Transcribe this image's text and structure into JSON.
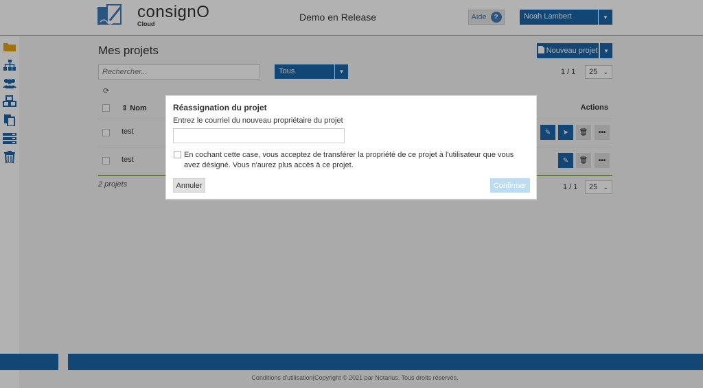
{
  "header": {
    "logo_text": "consignO",
    "logo_sub": "Cloud",
    "org_title": "Demo en Release",
    "help_label": "Aide",
    "help_icon": "?",
    "user_name": "Noah Lambert"
  },
  "sidebar": {
    "icons": [
      "folder-icon",
      "sitemap-icon",
      "users-icon",
      "cubes-icon",
      "documents-icon",
      "server-icon",
      "trash-icon"
    ],
    "active_color": "#e8a21a",
    "icon_color": "#1a66a8"
  },
  "main": {
    "title": "Mes projets",
    "new_project_label": "Nouveau projet",
    "search_placeholder": "Rechercher...",
    "filter_value": "Tous",
    "pager_top": "1  /  1",
    "page_size": "25",
    "columns": {
      "name": "Nom",
      "actions": "Actions"
    },
    "rows": [
      {
        "name": "test",
        "actions": [
          "edit-icon",
          "send-icon",
          "trash-icon",
          "more-icon"
        ]
      },
      {
        "name": "test",
        "actions": [
          "edit-icon",
          "trash-icon",
          "more-icon"
        ]
      }
    ],
    "count": "2 projets",
    "pager_bottom": "1  /  1"
  },
  "footer": {
    "copyright": "Conditions d'utilisation|Copyright © 2021 par Notarius. Tous droits réservés."
  },
  "modal": {
    "title": "Réassignation du projet",
    "label": "Entrez le courriel du nouveau propriétaire du projet",
    "input_value": "",
    "consent": "En cochant cette case, vous acceptez de transférer la propriété de ce projet à l'utilisateur que vous avez désigné. Vous n'aurez plus accès à ce projet.",
    "cancel_label": "Annuler",
    "confirm_label": "Confirmer"
  },
  "colors": {
    "primary": "#1a66a8",
    "accent_green": "#8cb44a",
    "confirm_disabled": "#bcdcf2"
  }
}
